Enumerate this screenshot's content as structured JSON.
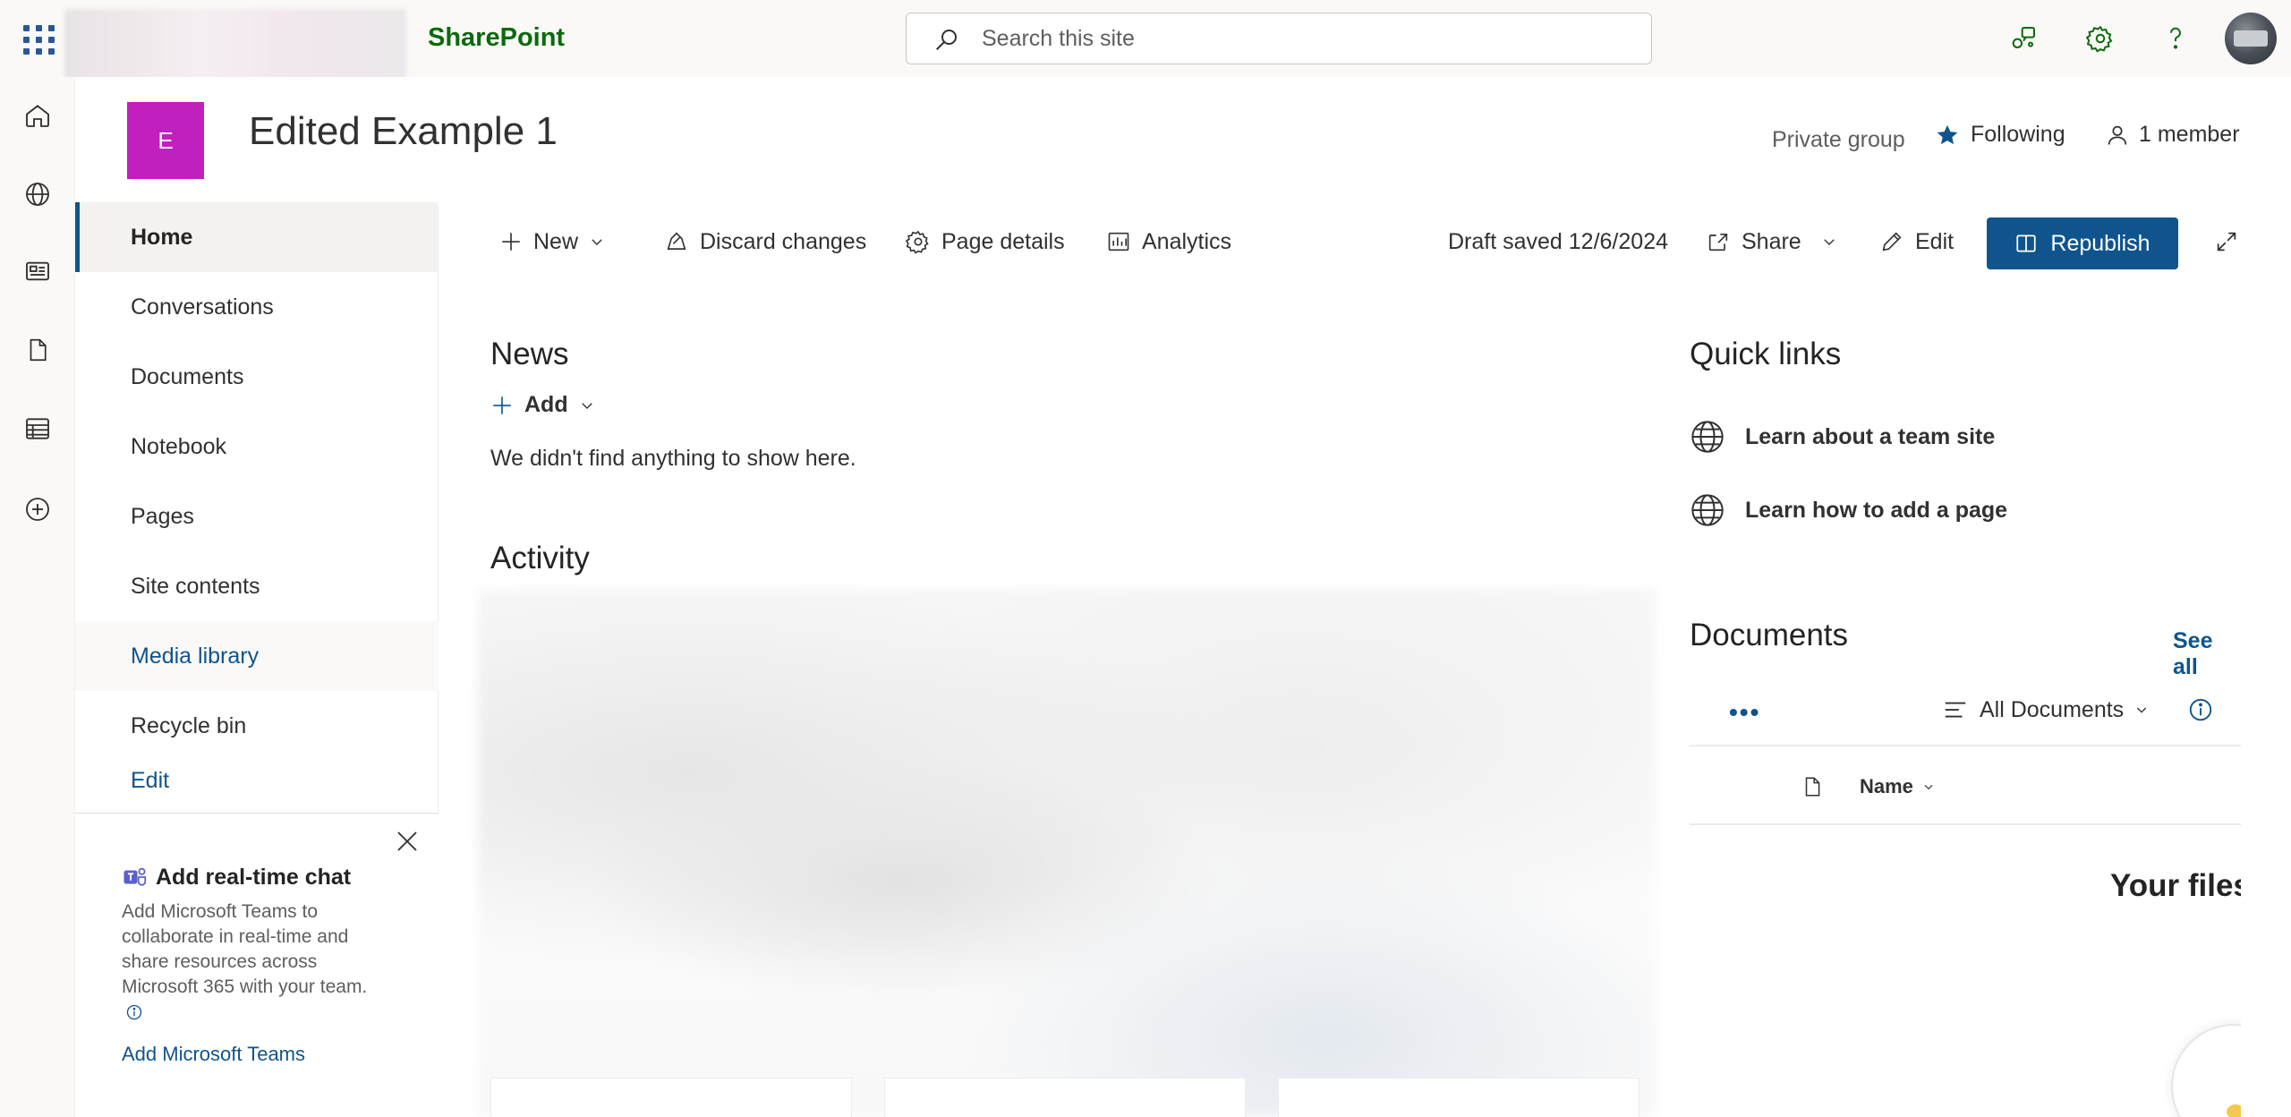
{
  "suite": {
    "app_name": "SharePoint",
    "search_placeholder": "Search this site"
  },
  "site": {
    "logo_letter": "E",
    "logo_color": "#c21fbf",
    "title": "Edited Example 1",
    "privacy": "Private group",
    "following_label": "Following",
    "members_label": "1 member"
  },
  "nav": {
    "items": [
      {
        "label": "Home"
      },
      {
        "label": "Conversations"
      },
      {
        "label": "Documents"
      },
      {
        "label": "Notebook"
      },
      {
        "label": "Pages"
      },
      {
        "label": "Site contents"
      },
      {
        "label": "Media library"
      },
      {
        "label": "Recycle bin"
      },
      {
        "label": "Edit"
      }
    ]
  },
  "teams_card": {
    "title": "Add real-time chat",
    "description": "Add Microsoft Teams to collaborate in real-time and share resources across Microsoft 365 with your team.",
    "link": "Add Microsoft Teams"
  },
  "commandbar": {
    "new_label": "New",
    "discard_label": "Discard changes",
    "page_details_label": "Page details",
    "analytics_label": "Analytics",
    "draft_status": "Draft saved 12/6/2024",
    "share_label": "Share",
    "edit_label": "Edit",
    "republish_label": "Republish"
  },
  "news": {
    "heading": "News",
    "add_label": "Add",
    "empty_message": "We didn't find anything to show here."
  },
  "activity": {
    "heading": "Activity"
  },
  "quick_links": {
    "heading": "Quick links",
    "items": [
      {
        "label": "Learn about a team site"
      },
      {
        "label": "Learn how to add a page"
      }
    ]
  },
  "documents": {
    "heading": "Documents",
    "see_all": "See all",
    "view_name": "All Documents",
    "name_column": "Name",
    "empty_title": "Your files"
  },
  "colors": {
    "brand": "#0f548c",
    "sharepoint_green": "#0b6a0b"
  }
}
